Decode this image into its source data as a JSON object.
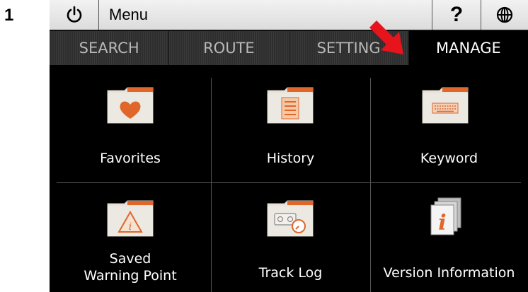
{
  "step_number": "1",
  "topbar": {
    "menu_label": "Menu",
    "help_label": "?",
    "power_icon": "power-icon",
    "globe_icon": "globe-icon"
  },
  "tabs": [
    {
      "label": "SEARCH",
      "active": false
    },
    {
      "label": "ROUTE",
      "active": false
    },
    {
      "label": "SETTING",
      "active": false
    },
    {
      "label": "MANAGE",
      "active": true
    }
  ],
  "items": [
    {
      "label": "Favorites",
      "icon": "heart-folder-icon"
    },
    {
      "label": "History",
      "icon": "list-folder-icon"
    },
    {
      "label": "Keyword",
      "icon": "keyboard-folder-icon"
    },
    {
      "label_line1": "Saved",
      "label_line2": "Warning Point",
      "icon": "warning-folder-icon"
    },
    {
      "label": "Track Log",
      "icon": "tracklog-folder-icon"
    },
    {
      "label": "Version Information",
      "icon": "info-document-icon"
    }
  ],
  "colors": {
    "accent_orange": "#e0662a",
    "arrow_red": "#e8141c"
  }
}
